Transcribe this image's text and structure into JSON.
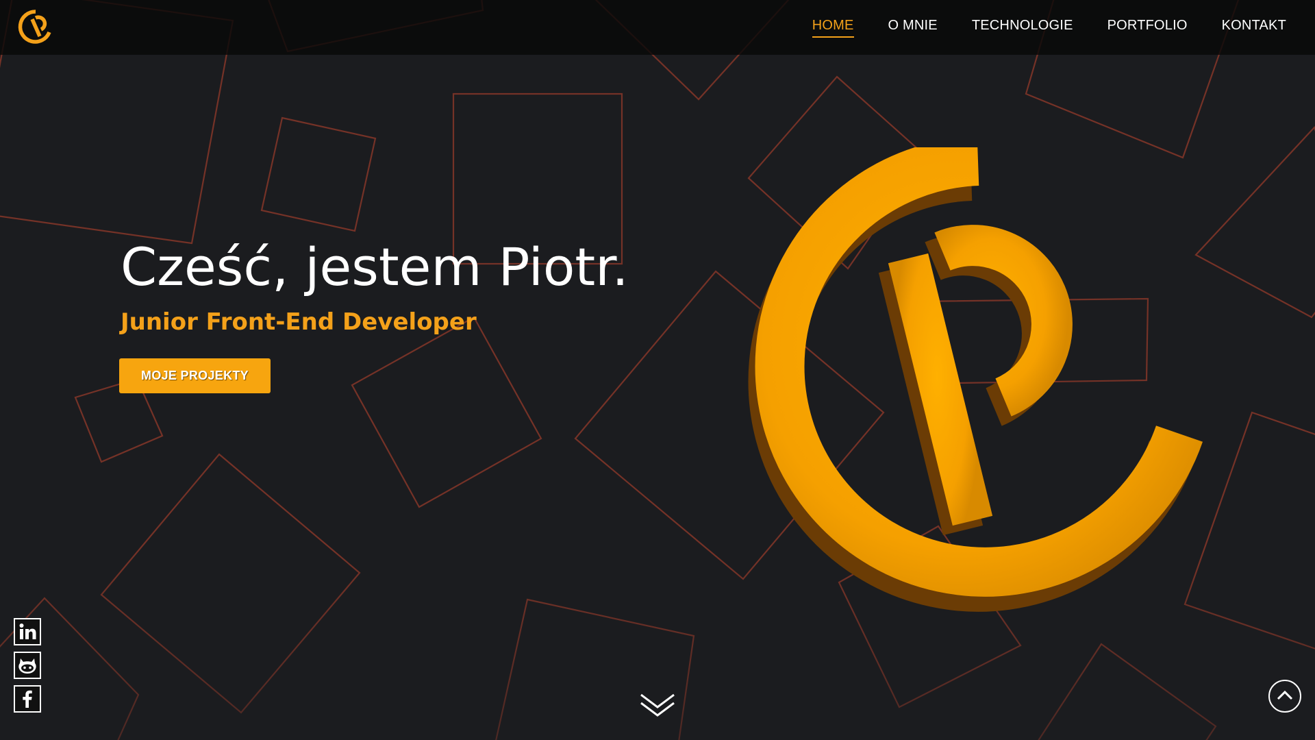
{
  "colors": {
    "accent": "#f4a11a",
    "background": "#1b1c1f",
    "shape_stroke": "#7a3428",
    "logo_dark": "#6b3c05"
  },
  "nav": {
    "items": [
      {
        "label": "HOME",
        "active": true
      },
      {
        "label": "O MNIE",
        "active": false
      },
      {
        "label": "TECHNOLOGIE",
        "active": false
      },
      {
        "label": "PORTFOLIO",
        "active": false
      },
      {
        "label": "KONTAKT",
        "active": false
      }
    ]
  },
  "hero": {
    "title": "Cześć, jestem Piotr.",
    "subtitle": "Junior Front-End Developer",
    "cta_label": "MOJE PROJEKTY"
  },
  "social": {
    "icons": [
      "linkedin-icon",
      "github-icon",
      "facebook-icon"
    ]
  },
  "icons": {
    "logo": "cp-logo-icon",
    "scroll_down": "double-chevron-down-icon",
    "back_to_top": "chevron-up-circle-icon"
  }
}
